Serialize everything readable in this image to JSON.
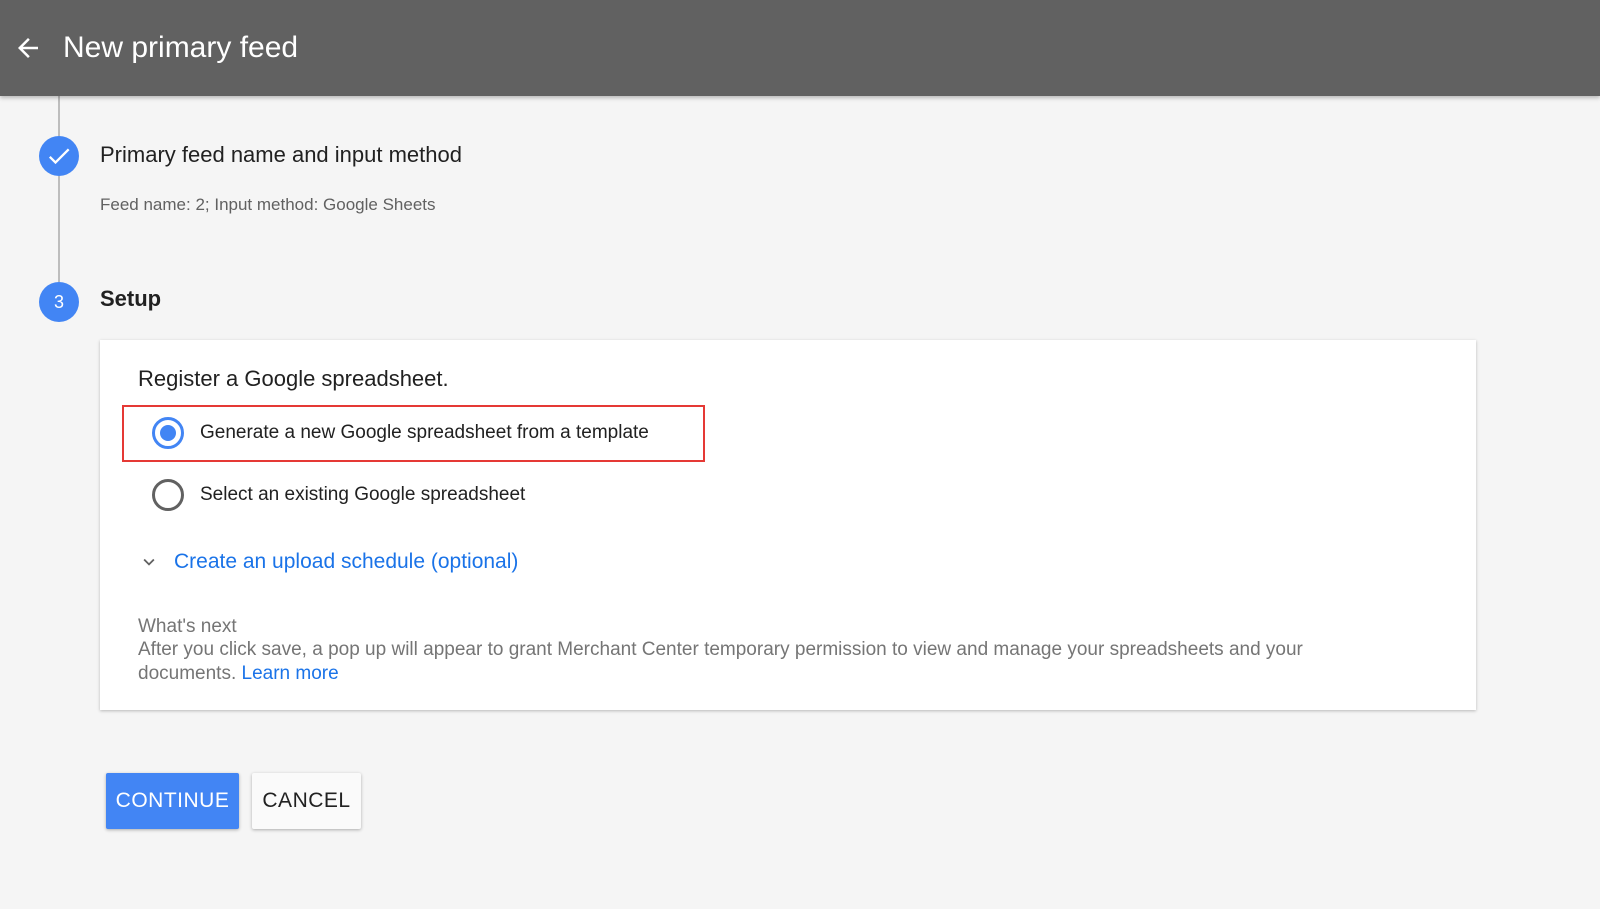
{
  "header": {
    "title": "New primary feed",
    "back_icon": "arrow-back-icon"
  },
  "steps": {
    "completed": {
      "title": "Primary feed name and input method",
      "summary": "Feed name: 2; Input method: Google Sheets",
      "icon": "check-icon"
    },
    "current": {
      "number": "3",
      "title": "Setup"
    }
  },
  "setup": {
    "heading": "Register a Google spreadsheet.",
    "options": [
      {
        "label": "Generate a new Google spreadsheet from a template",
        "selected": true
      },
      {
        "label": "Select an existing Google spreadsheet",
        "selected": false
      }
    ],
    "schedule_link": "Create an upload schedule (optional)",
    "whats_next": {
      "title": "What's next",
      "body": "After you click save, a pop up will appear to grant Merchant Center temporary permission to view and manage your spreadsheets and your documents.",
      "learn_more": "Learn more"
    }
  },
  "actions": {
    "continue_label": "CONTINUE",
    "cancel_label": "CANCEL"
  },
  "colors": {
    "header_bg": "#616161",
    "accent": "#4285f4",
    "link": "#1a73e8",
    "highlight_border": "#e53935"
  }
}
